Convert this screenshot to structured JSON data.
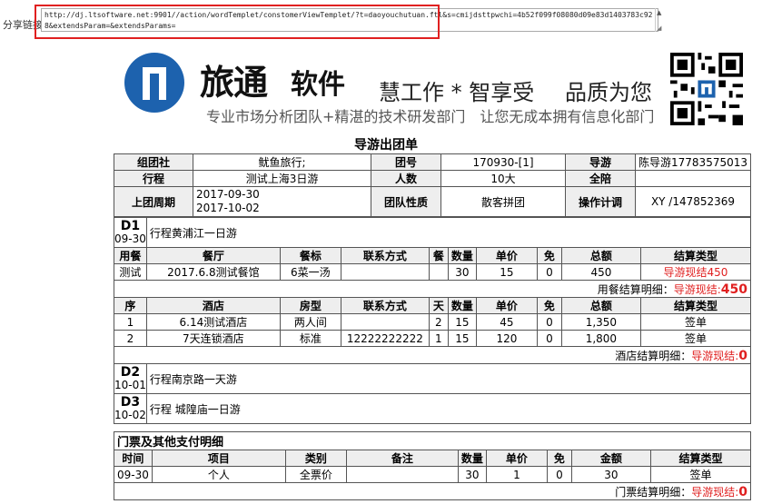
{
  "share": {
    "label": "分享链接:",
    "url": "http://dj.ltsoftware.net:9901//action/wordTemplet/constomerViewTemplet/?t=daoyouchutuan.ftl&s=cmijdsttpwchi=4b52f099f08080d09e83d1403783c928&extendsParam=&extendsParams="
  },
  "banner": {
    "brand": "旅通",
    "brand2": "软件",
    "slogan1": "慧工作 * 智享受",
    "slogan2": "品质为您",
    "tagline": "专业市场分析团队+精湛的技术研发部门　让您无成本拥有信息化部门",
    "colors": {
      "logo": "#1d62ae"
    }
  },
  "title": "导游出团单",
  "header": {
    "group_agency_label": "组团社",
    "group_agency": "鱿鱼旅行;",
    "group_no_label": "团号",
    "group_no": "170930-[1]",
    "guide_label": "导游",
    "guide": "陈导游17783575013",
    "itinerary_label": "行程",
    "itinerary": "测试上海3日游",
    "people_label": "人数",
    "people": "10大",
    "escort_label": "全陪",
    "escort": "",
    "period_label": "上团周期",
    "period_start": "2017-09-30",
    "period_end": "2017-10-02",
    "nature_label": "团队性质",
    "nature": "散客拼团",
    "planner_label": "操作计调",
    "planner": "XY /147852369"
  },
  "days": [
    {
      "day": "D1",
      "date": "09-30",
      "desc": "行程黄浦江一日游"
    },
    {
      "day": "D2",
      "date": "10-01",
      "desc": "行程南京路一天游"
    },
    {
      "day": "D3",
      "date": "10-02",
      "desc": "行程 城隍庙一日游"
    }
  ],
  "meal_table": {
    "headers": [
      "用餐",
      "餐厅",
      "餐标",
      "联系方式",
      "餐",
      "数量",
      "单价",
      "免",
      "总额",
      "结算类型"
    ],
    "rows": [
      [
        "测试",
        "2017.6.8测试餐馆",
        "6菜一汤",
        "",
        "",
        "30",
        "15",
        "0",
        "450",
        "导游现结450"
      ]
    ],
    "summary_label": "用餐结算明细：",
    "summary_type": "导游现结:",
    "summary_value": "450"
  },
  "hotel_table": {
    "headers": [
      "序",
      "酒店",
      "房型",
      "联系方式",
      "天",
      "数量",
      "单价",
      "免",
      "总额",
      "结算类型"
    ],
    "rows": [
      [
        "1",
        "6.14测试酒店",
        "两人间",
        "",
        "2",
        "15",
        "45",
        "0",
        "1,350",
        "签单"
      ],
      [
        "2",
        "7天连锁酒店",
        "标准",
        "12222222222",
        "1",
        "15",
        "120",
        "0",
        "1,800",
        "签单"
      ]
    ],
    "summary_label": "酒店结算明细：",
    "summary_type": "导游现结:",
    "summary_value": "0"
  },
  "tickets": {
    "section_title": "门票及其他支付明细",
    "headers": [
      "时间",
      "项目",
      "类别",
      "备注",
      "数量",
      "单价",
      "免",
      "金额",
      "结算类型"
    ],
    "rows": [
      [
        "09-30",
        "个人",
        "全票价",
        "",
        "30",
        "1",
        "0",
        "30",
        "签单"
      ]
    ],
    "summary_label": "门票结算明细：",
    "summary_type": "导游现结:",
    "summary_value": "0"
  }
}
